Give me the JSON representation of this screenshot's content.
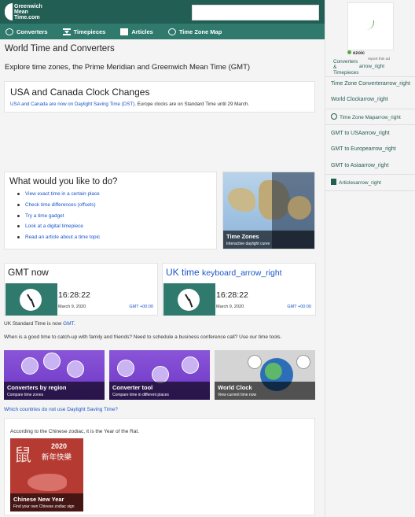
{
  "header": {
    "logo": "Greenwich Mean Time",
    "logo_line1": "Greenwich",
    "logo_line2": "Mean",
    "logo_line3": "Time.com",
    "search_placeholder": ""
  },
  "nav": {
    "items": [
      {
        "label": "Converters",
        "icon": "globe-icon"
      },
      {
        "label": "Timepieces",
        "icon": "hourglass-icon"
      },
      {
        "label": "Articles",
        "icon": "document-icon"
      },
      {
        "label": "Time Zone Map",
        "icon": "earth-icon"
      }
    ]
  },
  "page": {
    "title": "World Time and Converters",
    "intro": "Explore time zones, the Prime Meridian and Greenwich Mean Time (GMT)"
  },
  "dst": {
    "title": "USA and Canada Clock Changes",
    "link": "USA and Canada are now on Daylight Saving Time (DST).",
    "text": " Europe clocks are on Standard Time until 29 March."
  },
  "todo": {
    "title": "What would you like to do?",
    "items": [
      "View exact time in a certain place",
      "Check time differences (offsets)",
      "Try a time gadget",
      "Look at a digital timepiece",
      "Read an article about a time topic"
    ]
  },
  "tzmap": {
    "title": "Time Zones",
    "subtitle": "Interactive daylight curve"
  },
  "gmt_now": {
    "title": "GMT now",
    "time": "16:28:22",
    "date": "March 9, 2020",
    "offset": "GMT +00:00"
  },
  "uk_time": {
    "title": "UK time",
    "icon_text": "keyboard_arrow_right",
    "time": "16:28:22",
    "date": "March 9, 2020",
    "offset": "GMT +00:00"
  },
  "uk_standard": {
    "text": "UK Standard Time is now ",
    "link": "GMT",
    "end": "."
  },
  "tools_line": "When is a good time to catch-up with family and friends? Need to schedule a business conference call? Use our time tools.",
  "tiles": [
    {
      "title": "Converters by region",
      "subtitle": "Compare time zones"
    },
    {
      "title": "Converter tool",
      "subtitle": "Compare time in different places"
    },
    {
      "title": "World Clock",
      "subtitle": "View current time now"
    }
  ],
  "dst_link": "Which countries do not use Daylight Saving Time?",
  "zodiac": {
    "text": "According to the Chinese zodiac, it is the Year of the Rat.",
    "big_char": "鼠",
    "year": "2020",
    "greeting": "新年快樂",
    "title": "Chinese New Year",
    "subtitle": "Find your own Chinese zodiac sign"
  },
  "sidebar": {
    "ezoic": "ezoic",
    "report": "report this ad",
    "head_line1": "Converters",
    "head_line2": "&",
    "head_line3": "Timepieces",
    "head_arrow": "arrow_right",
    "items": [
      "Time Zone Converterarrow_right",
      "World Clockarrow_right",
      "Time Zone Maparrow_right",
      "GMT to USAarrow_right",
      "GMT to Europearrow_right",
      "GMT to Asiaarrow_right",
      "Articlesarrow_right"
    ]
  },
  "colors": {
    "header": "#235e54",
    "nav": "#2f7a6d",
    "link": "#1a55c9",
    "tile_purple": "#7b45cf"
  }
}
